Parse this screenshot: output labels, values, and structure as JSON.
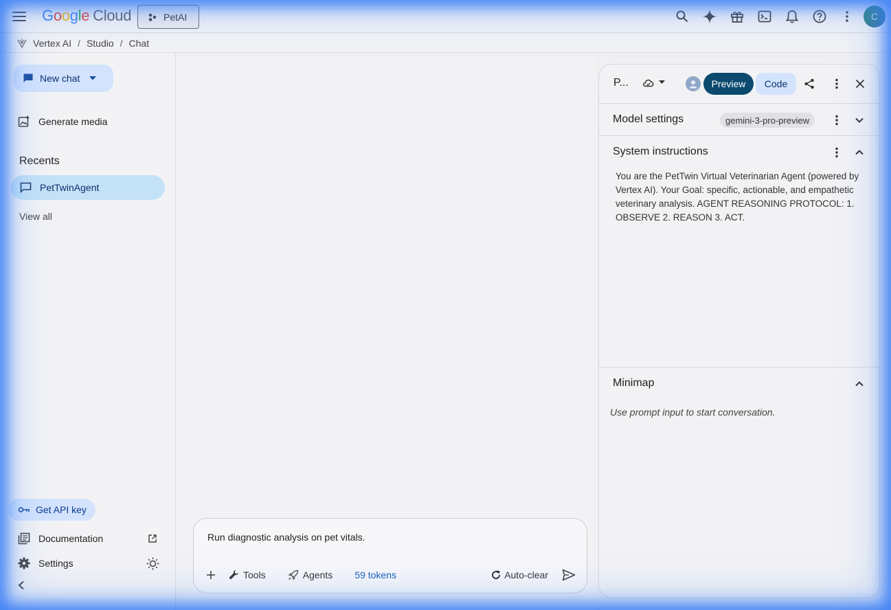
{
  "topbar": {
    "logo_google": "Google",
    "logo_cloud": "Cloud",
    "project_label": "PetAI",
    "avatar_letter": "C"
  },
  "breadcrumb": {
    "items": [
      "Vertex AI",
      "Studio",
      "Chat"
    ]
  },
  "sidebar": {
    "new_chat_label": "New chat",
    "generate_media_label": "Generate media",
    "recents_heading": "Recents",
    "recent_items": [
      {
        "label": "PetTwinAgent"
      }
    ],
    "view_all_label": "View all",
    "api_key_label": "Get API key",
    "documentation_label": "Documentation",
    "settings_label": "Settings"
  },
  "prompt": {
    "text": "Run diagnostic analysis on pet vitals.",
    "tools_label": "Tools",
    "agents_label": "Agents",
    "tokens_label": "59 tokens",
    "autoclear_label": "Auto-clear"
  },
  "right_panel": {
    "title": "P...",
    "preview_label": "Preview",
    "code_label": "Code",
    "model_settings_title": "Model settings",
    "model_chip": "gemini-3-pro-preview",
    "system_instructions_title": "System instructions",
    "system_instructions_text": "You are the PetTwin Virtual Veterinarian Agent (powered by Vertex AI). Your Goal: specific, actionable, and empathetic veterinary analysis. AGENT REASONING PROTOCOL: 1. OBSERVE 2. REASON 3. ACT.",
    "minimap_title": "Minimap",
    "minimap_placeholder": "Use prompt input to start conversation."
  },
  "colors": {
    "accent_blue_glow": "#2e76f5",
    "chip_blue": "#d3e3fd",
    "preview_button": "#0b4a6e",
    "recent_selected": "#c4e2f7",
    "token_link": "#1a5fbf"
  }
}
